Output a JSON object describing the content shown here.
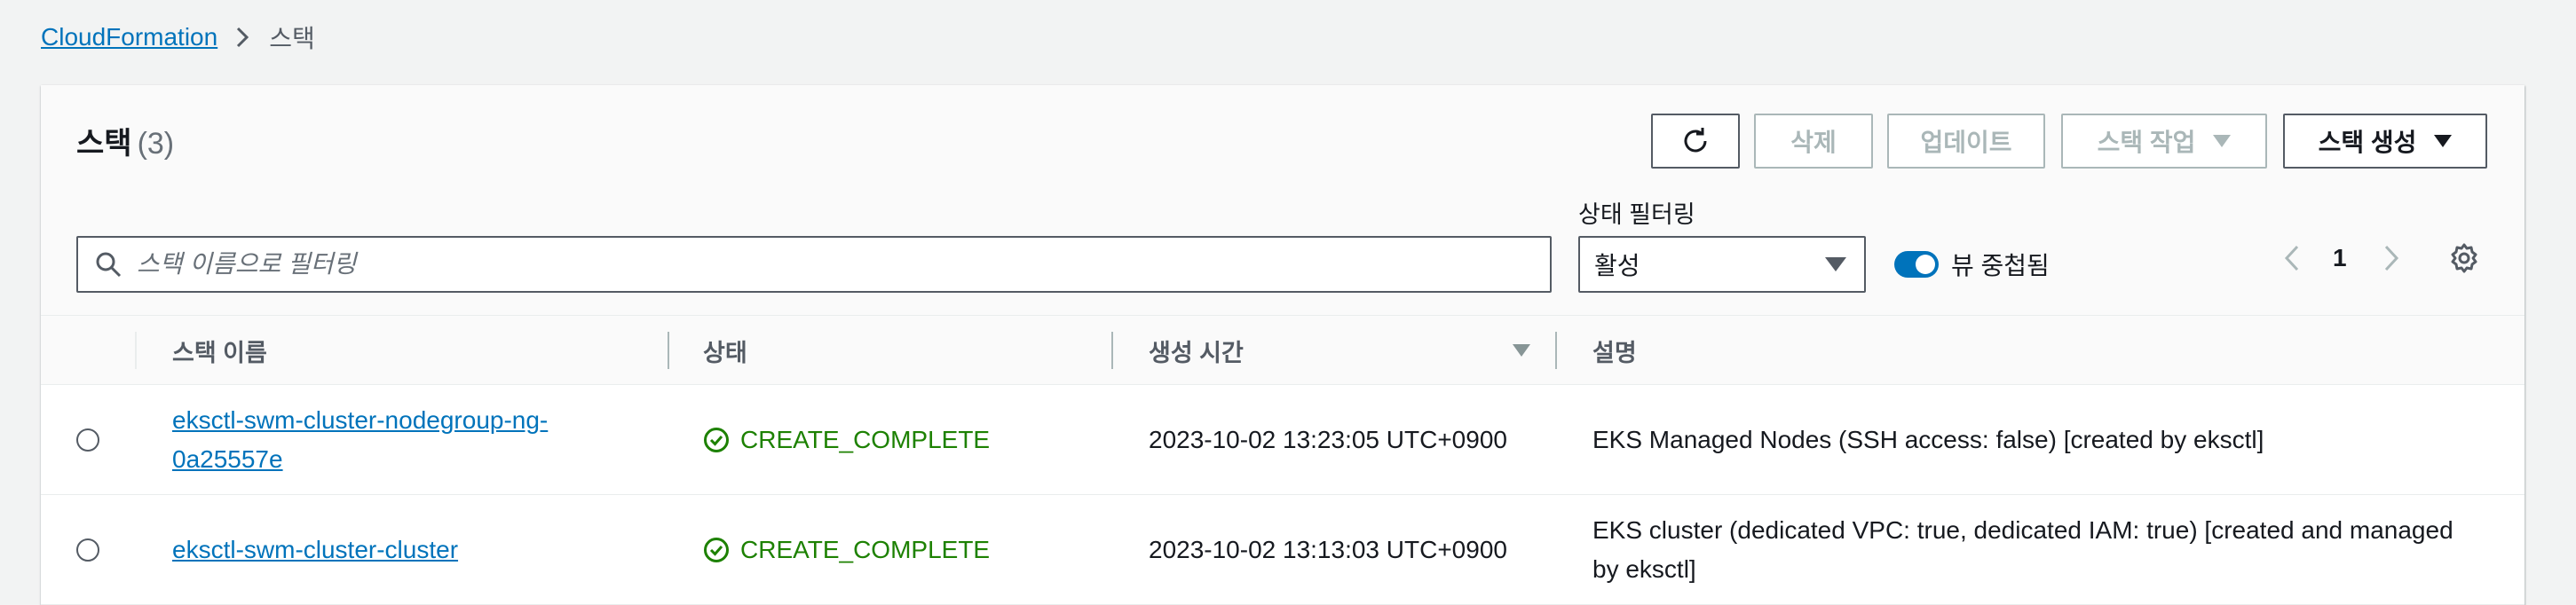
{
  "breadcrumb": {
    "root": "CloudFormation",
    "current": "스택"
  },
  "header": {
    "title": "스택",
    "count": "(3)"
  },
  "toolbar": {
    "delete": "삭제",
    "update": "업데이트",
    "stack_actions": "스택 작업",
    "create_stack": "스택 생성"
  },
  "filter": {
    "search_placeholder": "스택 이름으로 필터링",
    "status_label": "상태 필터링",
    "status_value": "활성",
    "nested_toggle_label": "뷰 중첩됨"
  },
  "pagination": {
    "page": "1"
  },
  "table": {
    "columns": [
      "스택 이름",
      "상태",
      "생성 시간",
      "설명"
    ],
    "rows": [
      {
        "name_line1": "eksctl-swm-cluster-nodegroup-ng-",
        "name_line2": "0a25557e",
        "status": "CREATE_COMPLETE",
        "created": "2023-10-02 13:23:05 UTC+0900",
        "description": "EKS Managed Nodes (SSH access: false) [created by eksctl]"
      },
      {
        "name": "eksctl-swm-cluster-cluster",
        "status": "CREATE_COMPLETE",
        "created": "2023-10-02 13:13:03 UTC+0900",
        "description_line1": "EKS cluster (dedicated VPC: true, dedicated IAM: true) [created and managed",
        "description_line2": "by eksctl]"
      }
    ]
  },
  "colors": {
    "link": "#0073bb",
    "success": "#1d8102",
    "toggle_on": "#0073bb"
  },
  "icons": [
    "chevron-right-icon",
    "refresh-icon",
    "caret-down-icon",
    "search-icon",
    "chevron-left-icon",
    "gear-icon",
    "sort-down-icon",
    "status-success-icon"
  ]
}
